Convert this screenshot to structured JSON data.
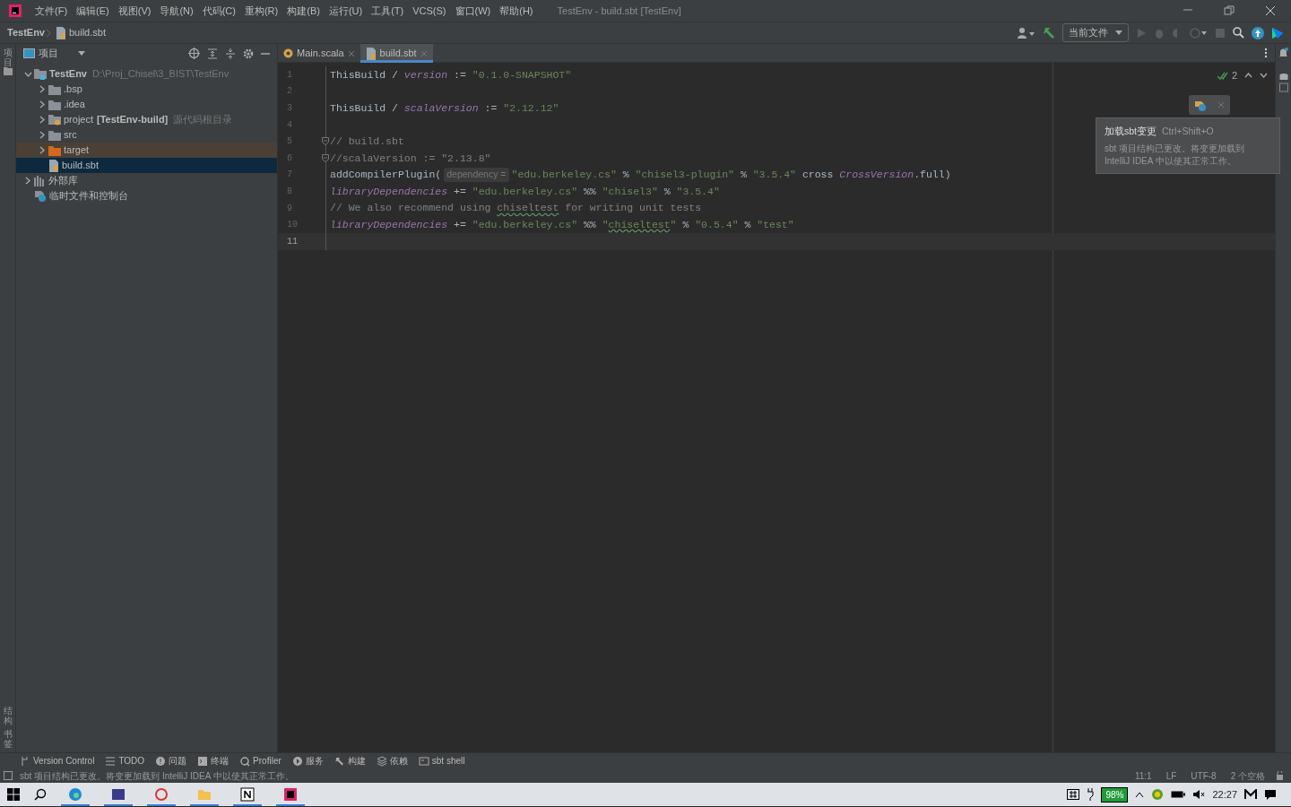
{
  "window": {
    "title": "TestEnv - build.sbt [TestEnv]"
  },
  "menu": [
    "文件(F)",
    "编辑(E)",
    "视图(V)",
    "导航(N)",
    "代码(C)",
    "重构(R)",
    "构建(B)",
    "运行(U)",
    "工具(T)",
    "VCS(S)",
    "窗口(W)",
    "帮助(H)"
  ],
  "breadcrumb": [
    "TestEnv",
    "build.sbt"
  ],
  "run_config": "当前文件",
  "left_stripe": {
    "top": "项目",
    "bottom": [
      "结构",
      "书签"
    ]
  },
  "project_panel": {
    "title": "项目",
    "tree": [
      {
        "name": "TestEnv",
        "path": "D:\\Proj_Chisel\\3_BIST\\TestEnv",
        "kind": "module",
        "expanded": true,
        "selected": false,
        "children": [
          {
            "name": ".bsp",
            "kind": "folder",
            "expanded": false,
            "selected": false
          },
          {
            "name": ".idea",
            "kind": "folder",
            "expanded": false,
            "selected": false
          },
          {
            "name": "project",
            "module": "[TestEnv-build]",
            "note": "源代码根目录",
            "kind": "source-root",
            "expanded": false,
            "selected": false
          },
          {
            "name": "src",
            "kind": "folder",
            "expanded": false,
            "selected": false
          },
          {
            "name": "target",
            "kind": "excluded",
            "expanded": false,
            "selected": false
          },
          {
            "name": "build.sbt",
            "kind": "sbt-file",
            "selected": true
          }
        ]
      },
      {
        "name": "外部库",
        "kind": "library",
        "expanded": false,
        "selected": false
      },
      {
        "name": "临时文件和控制台",
        "kind": "scratch",
        "selected": false
      }
    ]
  },
  "editor_tabs": [
    {
      "label": "Main.scala",
      "kind": "scala",
      "selected": false
    },
    {
      "label": "build.sbt",
      "kind": "sbt",
      "selected": true
    }
  ],
  "inspection": {
    "count": "2"
  },
  "code": [
    {
      "number": "1",
      "fold": false,
      "current": false,
      "tokens": [
        {
          "kind": "plain",
          "text": "ThisBuild / "
        },
        {
          "kind": "field",
          "text": "version"
        },
        {
          "kind": "plain",
          "text": " := "
        },
        {
          "kind": "string",
          "text": "\"0.1.0-SNAPSHOT\""
        }
      ]
    },
    {
      "number": "2",
      "fold": false,
      "current": false
    },
    {
      "number": "3",
      "fold": false,
      "current": false,
      "tokens": [
        {
          "kind": "plain",
          "text": "ThisBuild / "
        },
        {
          "kind": "field",
          "text": "scalaVersion"
        },
        {
          "kind": "plain",
          "text": " := "
        },
        {
          "kind": "string",
          "text": "\"2.12.12\""
        }
      ]
    },
    {
      "number": "4",
      "fold": false,
      "current": false
    },
    {
      "number": "5",
      "fold": true,
      "current": false,
      "tokens": [
        {
          "kind": "comment",
          "text": "// build.sbt"
        }
      ]
    },
    {
      "number": "6",
      "fold": true,
      "current": false,
      "tokens": [
        {
          "kind": "comment",
          "text": "//scalaVersion := \"2.13.8\""
        }
      ]
    },
    {
      "number": "7",
      "fold": false,
      "current": false,
      "tokens": [
        {
          "kind": "plain",
          "text": "addCompilerPlugin("
        },
        {
          "kind": "hint",
          "text": "dependency ="
        },
        {
          "kind": "string",
          "text": "\"edu.berkeley.cs\""
        },
        {
          "kind": "plain",
          "text": " % "
        },
        {
          "kind": "string",
          "text": "\"chisel3-plugin\""
        },
        {
          "kind": "plain",
          "text": " % "
        },
        {
          "kind": "string",
          "text": "\"3.5.4\""
        },
        {
          "kind": "plain",
          "text": " cross "
        },
        {
          "kind": "type",
          "text": "CrossVersion"
        },
        {
          "kind": "plain",
          "text": ".full)"
        }
      ]
    },
    {
      "number": "8",
      "fold": false,
      "current": false,
      "tokens": [
        {
          "kind": "field",
          "text": "libraryDependencies"
        },
        {
          "kind": "plain",
          "text": " += "
        },
        {
          "kind": "string",
          "text": "\"edu.berkeley.cs\""
        },
        {
          "kind": "plain",
          "text": " %% "
        },
        {
          "kind": "string",
          "text": "\"chisel3\""
        },
        {
          "kind": "plain",
          "text": " % "
        },
        {
          "kind": "string",
          "text": "\"3.5.4\""
        }
      ]
    },
    {
      "number": "9",
      "fold": false,
      "current": false,
      "tokens": [
        {
          "kind": "comment",
          "text": "// We also recommend using "
        },
        {
          "kind": "comment-typo",
          "text": "chiseltest"
        },
        {
          "kind": "comment",
          "text": " for writing unit tests"
        }
      ]
    },
    {
      "number": "10",
      "fold": false,
      "current": false,
      "tokens": [
        {
          "kind": "field",
          "text": "libraryDependencies"
        },
        {
          "kind": "plain",
          "text": " += "
        },
        {
          "kind": "string",
          "text": "\"edu.berkeley.cs\""
        },
        {
          "kind": "plain",
          "text": " %% "
        },
        {
          "kind": "string",
          "text": "\""
        },
        {
          "kind": "string-typo",
          "text": "chiseltest"
        },
        {
          "kind": "string",
          "text": "\""
        },
        {
          "kind": "plain",
          "text": " % "
        },
        {
          "kind": "string",
          "text": "\"0.5.4\""
        },
        {
          "kind": "plain",
          "text": " % "
        },
        {
          "kind": "string",
          "text": "\"test\""
        }
      ]
    },
    {
      "number": "11",
      "fold": false,
      "current": true
    }
  ],
  "notification": {
    "title": "加载sbt变更",
    "shortcut": "Ctrl+Shift+O",
    "body": "sbt 项目结构已更改。将变更加载到 IntelliJ IDEA 中以使其正常工作。"
  },
  "tool_windows": [
    {
      "label": "Version Control",
      "kind": "vcs"
    },
    {
      "label": "TODO",
      "kind": "todo"
    },
    {
      "label": "问题",
      "kind": "problems"
    },
    {
      "label": "终端",
      "kind": "terminal"
    },
    {
      "label": "Profiler",
      "kind": "profiler"
    },
    {
      "label": "服务",
      "kind": "services"
    },
    {
      "label": "构建",
      "kind": "build"
    },
    {
      "label": "依赖",
      "kind": "deps"
    },
    {
      "label": "sbt shell",
      "kind": "shell"
    }
  ],
  "status_bar": {
    "message": "sbt 项目结构已更改。将变更加载到 IntelliJ IDEA 中以使其正常工作。",
    "items": [
      "11:1",
      "LF",
      "UTF-8",
      "2 个空格"
    ]
  },
  "taskbar": {
    "battery": "98%",
    "time": "22:27"
  }
}
